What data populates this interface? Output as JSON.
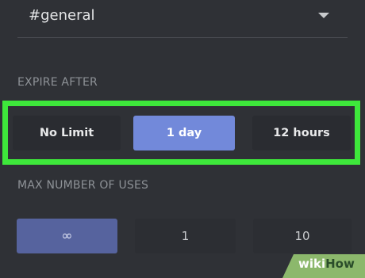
{
  "channel": {
    "selected": "#general"
  },
  "expire": {
    "label": "EXPIRE AFTER",
    "options": [
      "No Limit",
      "1 day",
      "12 hours"
    ],
    "selected": "1 day"
  },
  "max_uses": {
    "label": "MAX NUMBER OF USES",
    "options": [
      "∞",
      "1",
      "10"
    ],
    "selected": "∞"
  },
  "watermark": {
    "part1": "wiki",
    "part2": "How"
  },
  "colors": {
    "background": "#2f3136",
    "selected_option": "#7289da",
    "highlight": "#3ee83b"
  }
}
